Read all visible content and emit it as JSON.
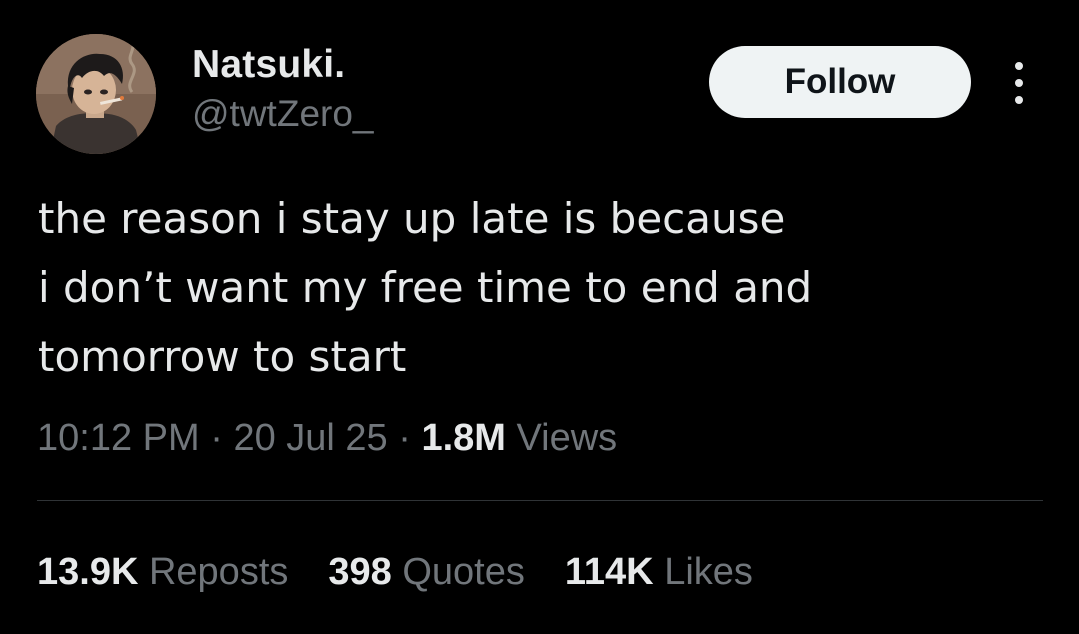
{
  "user": {
    "display_name": "Natsuki.",
    "handle": "@twtZero_",
    "avatar_icon": "anime-character-avatar"
  },
  "actions": {
    "follow_label": "Follow",
    "more_icon": "more-options-vertical-dots-icon"
  },
  "tweet": {
    "lines": [
      "the reason i stay up late is because",
      "i don’t want my free time to end and",
      "tomorrow to start"
    ]
  },
  "meta": {
    "time": "10:12 PM",
    "separator": "·",
    "date": "20 Jul 25",
    "views_count": "1.8M",
    "views_label": "Views"
  },
  "stats": {
    "reposts_count": "13.9K",
    "reposts_label": "Reposts",
    "quotes_count": "398",
    "quotes_label": "Quotes",
    "likes_count": "114K",
    "likes_label": "Likes"
  },
  "colors": {
    "background": "#000000",
    "primary_text": "#e7e9ea",
    "secondary_text": "#71767b",
    "follow_bg": "#eff3f4",
    "divider": "#2f3336"
  }
}
